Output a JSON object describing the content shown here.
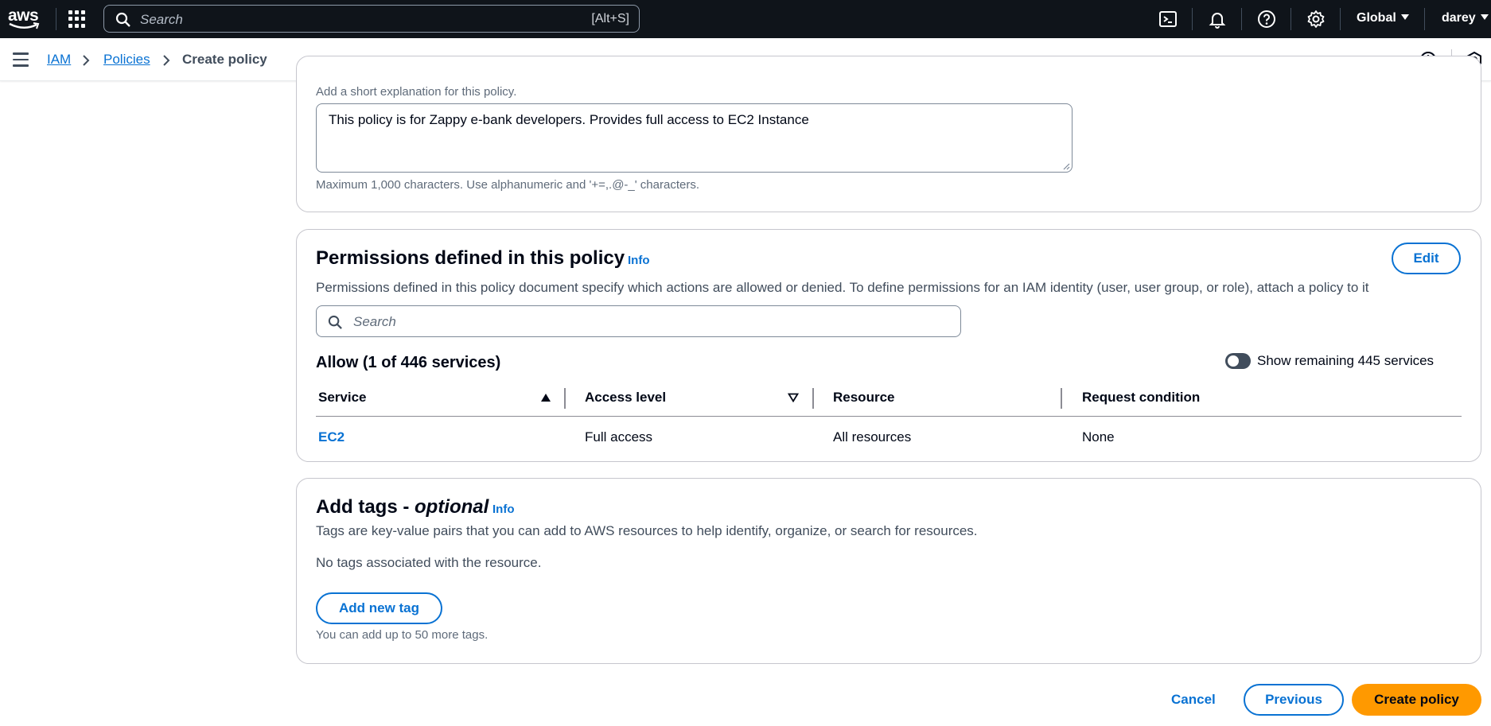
{
  "topnav": {
    "logo_text": "aws",
    "search_placeholder": "Search",
    "search_shortcut": "[Alt+S]",
    "region": "Global",
    "user": "darey",
    "icons": [
      "cloudshell-icon",
      "bell-icon",
      "help-icon",
      "settings-icon"
    ]
  },
  "breadcrumb": {
    "items": [
      {
        "label": "IAM"
      },
      {
        "label": "Policies"
      },
      {
        "label": "Create policy"
      }
    ]
  },
  "description_section": {
    "hint": "Add a short explanation for this policy.",
    "value": "This policy is for Zappy e-bank developers. Provides full access to EC2 Instance",
    "constraint": "Maximum 1,000 characters. Use alphanumeric and '+=,.@-_' characters."
  },
  "permissions": {
    "title": "Permissions defined in this policy",
    "info": "Info",
    "edit_label": "Edit",
    "description": "Permissions defined in this policy document specify which actions are allowed or denied. To define permissions for an IAM identity (user, user group, or role), attach a policy to it",
    "search_placeholder": "Search",
    "allow_title": "Allow (1 of 446 services)",
    "toggle_label": "Show remaining 445 services",
    "toggle_on": false,
    "columns": [
      "Service",
      "Access level",
      "Resource",
      "Request condition"
    ],
    "rows": [
      {
        "service": "EC2",
        "access_level": "Full access",
        "resource": "All resources",
        "request_condition": "None"
      }
    ]
  },
  "tags": {
    "title": "Add tags -",
    "title_optional": "optional",
    "info": "Info",
    "description": "Tags are key-value pairs that you can add to AWS resources to help identify, organize, or search for resources.",
    "empty_text": "No tags associated with the resource.",
    "add_button": "Add new tag",
    "limit_text": "You can add up to 50 more tags."
  },
  "footer": {
    "cancel": "Cancel",
    "previous": "Previous",
    "create": "Create policy"
  },
  "colors": {
    "nav_bg": "#0f141a",
    "link": "#0972d3",
    "primary": "#ff9900"
  }
}
